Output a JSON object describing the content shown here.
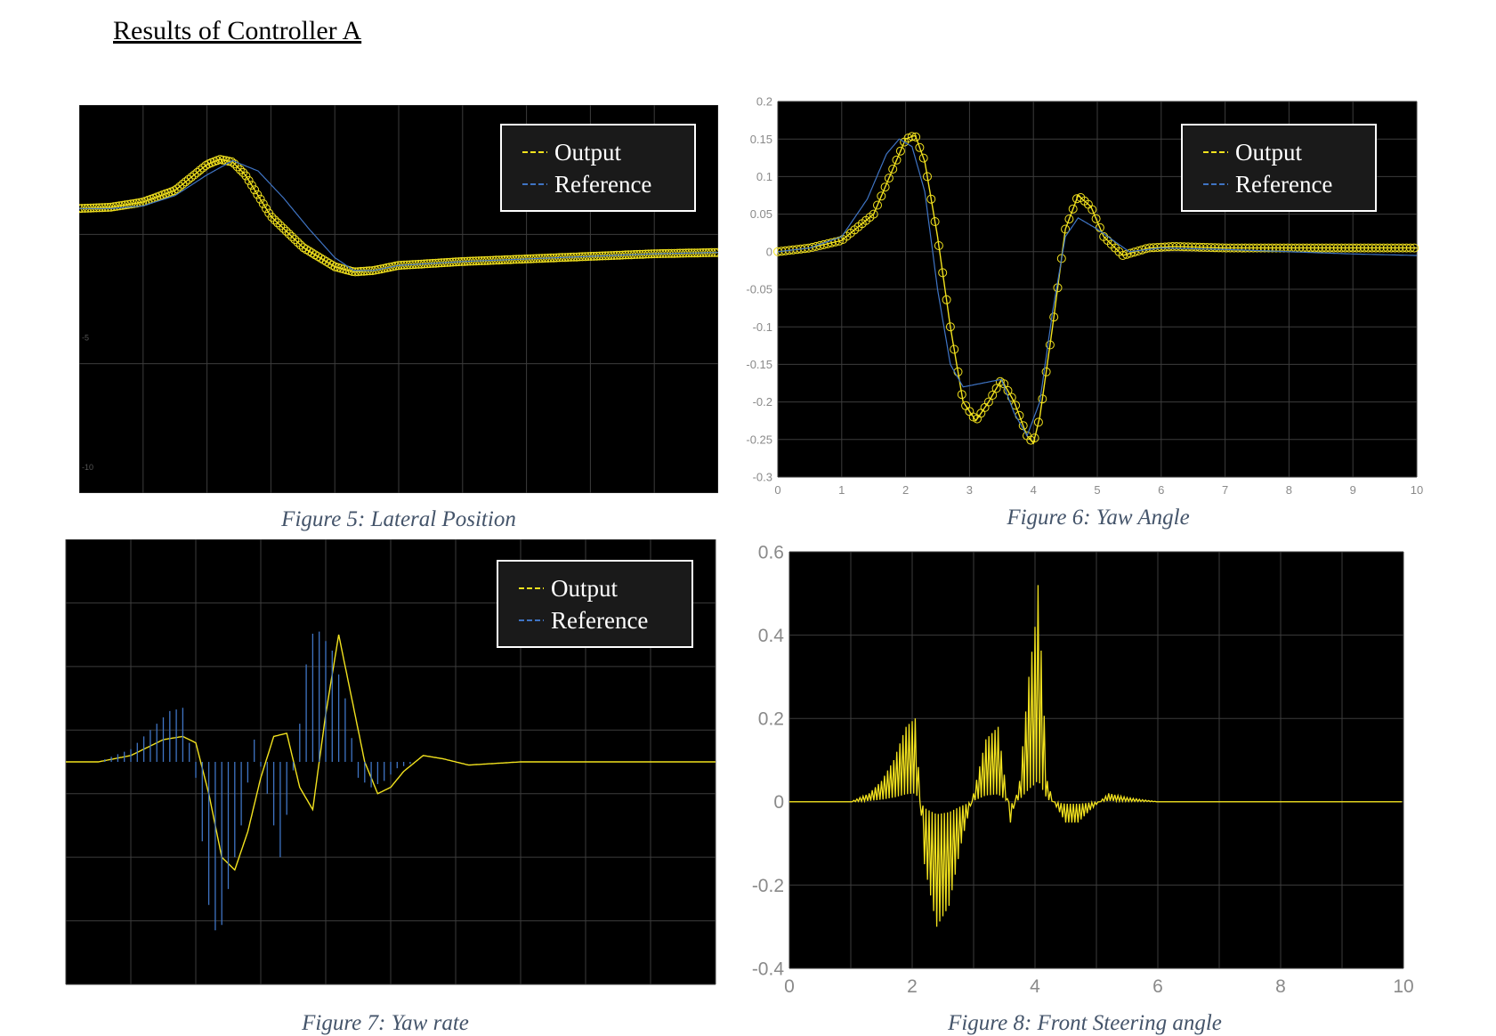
{
  "page": {
    "title": "Results of Controller A"
  },
  "colors": {
    "output": "#f2e21e",
    "reference": "#3f74c4",
    "background": "#000000",
    "grid": "#3c3c3c",
    "tick_text": "#8a8a8a",
    "caption": "#44546a"
  },
  "legend": {
    "output_label": "Output",
    "reference_label": "Reference"
  },
  "chart_data": [
    {
      "id": "fig5",
      "type": "line",
      "caption": "Figure 5: Lateral Position",
      "title": "",
      "xlabel": "",
      "ylabel": "",
      "xlim": [
        0,
        10
      ],
      "ylim": [
        -11,
        4
      ],
      "yticks": [
        -5,
        -10
      ],
      "grid": true,
      "legend": "top-right",
      "markers": "circle-dense",
      "series": [
        {
          "name": "Output",
          "x": [
            0,
            0.5,
            1,
            1.5,
            2,
            2.2,
            2.4,
            2.6,
            2.8,
            3,
            3.5,
            4,
            4.3,
            4.6,
            5,
            6,
            7,
            8,
            9,
            10
          ],
          "values": [
            0,
            0.05,
            0.25,
            0.7,
            1.7,
            1.9,
            1.8,
            1.3,
            0.5,
            -0.3,
            -1.5,
            -2.25,
            -2.45,
            -2.4,
            -2.2,
            -2.05,
            -1.95,
            -1.85,
            -1.75,
            -1.7
          ]
        },
        {
          "name": "Reference",
          "x": [
            0,
            0.5,
            1,
            1.5,
            2,
            2.4,
            2.8,
            3.2,
            3.6,
            4,
            4.3,
            4.6,
            5,
            6,
            7,
            8,
            9,
            10
          ],
          "values": [
            0,
            0,
            0.1,
            0.5,
            1.3,
            1.85,
            1.45,
            0.4,
            -0.8,
            -1.9,
            -2.4,
            -2.4,
            -2.2,
            -2.05,
            -1.95,
            -1.85,
            -1.75,
            -1.7
          ]
        }
      ]
    },
    {
      "id": "fig6",
      "type": "line",
      "caption": "Figure 6: Yaw Angle",
      "title": "",
      "xlabel": "",
      "ylabel": "",
      "xlim": [
        0,
        10
      ],
      "ylim": [
        -0.3,
        0.2
      ],
      "xticks": [
        "0",
        "1",
        "2",
        "3",
        "4",
        "5",
        "6",
        "7",
        "8",
        "9",
        "10"
      ],
      "yticks": [
        "0.2",
        "0.15",
        "0.1",
        "0.05",
        "0",
        "-0.05",
        "-0.1",
        "-0.15",
        "-0.2",
        "-0.25",
        "-0.3"
      ],
      "grid": true,
      "legend": "top-right",
      "markers": "circle",
      "series": [
        {
          "name": "Output",
          "x": [
            0,
            0.5,
            1,
            1.5,
            1.8,
            2,
            2.15,
            2.3,
            2.5,
            2.7,
            2.9,
            3.1,
            3.3,
            3.5,
            3.7,
            3.9,
            4,
            4.1,
            4.3,
            4.5,
            4.7,
            4.9,
            5.1,
            5.4,
            5.8,
            6.2,
            7,
            8,
            9,
            10
          ],
          "values": [
            0,
            0.005,
            0.015,
            0.05,
            0.11,
            0.15,
            0.155,
            0.12,
            0.02,
            -0.1,
            -0.2,
            -0.225,
            -0.2,
            -0.17,
            -0.2,
            -0.245,
            -0.255,
            -0.22,
            -0.1,
            0.03,
            0.075,
            0.06,
            0.02,
            -0.005,
            0.005,
            0.007,
            0.005,
            0.005,
            0.005,
            0.005
          ]
        },
        {
          "name": "Reference",
          "x": [
            0,
            0.5,
            1,
            1.4,
            1.7,
            1.9,
            2.1,
            2.3,
            2.5,
            2.7,
            2.9,
            3.2,
            3.5,
            3.7,
            3.9,
            4.1,
            4.3,
            4.5,
            4.7,
            5,
            5.5,
            6,
            7,
            8,
            9,
            10
          ],
          "values": [
            0,
            0.005,
            0.02,
            0.07,
            0.13,
            0.15,
            0.14,
            0.08,
            -0.05,
            -0.15,
            -0.18,
            -0.175,
            -0.17,
            -0.215,
            -0.245,
            -0.2,
            -0.08,
            0.02,
            0.045,
            0.03,
            0,
            0.005,
            0.003,
            0,
            -0.003,
            -0.005
          ]
        }
      ]
    },
    {
      "id": "fig7",
      "type": "line",
      "caption": "Figure 7: Yaw rate",
      "title": "",
      "xlabel": "",
      "ylabel": "",
      "xlim": [
        0,
        10
      ],
      "ylim": [
        -0.07,
        0.07
      ],
      "grid": true,
      "legend": "top-right",
      "series": [
        {
          "name": "Output",
          "x": [
            0,
            0.5,
            1,
            1.5,
            1.8,
            2,
            2.2,
            2.4,
            2.6,
            2.8,
            3,
            3.2,
            3.4,
            3.6,
            3.8,
            4,
            4.2,
            4.4,
            4.6,
            4.8,
            5,
            5.2,
            5.5,
            5.8,
            6.2,
            7,
            8,
            9,
            10
          ],
          "values": [
            0,
            0,
            0.002,
            0.007,
            0.008,
            0.006,
            -0.01,
            -0.03,
            -0.034,
            -0.022,
            -0.005,
            0.008,
            0.009,
            -0.008,
            -0.015,
            0.015,
            0.04,
            0.02,
            0,
            -0.01,
            -0.008,
            -0.003,
            0.002,
            0.001,
            -0.001,
            0,
            0,
            0,
            0
          ]
        },
        {
          "name": "Reference",
          "x": [
            0,
            0.5,
            1,
            1.3,
            1.6,
            1.8,
            2,
            2.2,
            2.35,
            2.5,
            2.7,
            2.9,
            3.1,
            3.3,
            3.45,
            3.6,
            3.75,
            3.9,
            4.1,
            4.3,
            4.5,
            4.7,
            4.9,
            5.1,
            5.4,
            6,
            7,
            8,
            9,
            10
          ],
          "values": [
            0,
            0,
            0.004,
            0.01,
            0.016,
            0.017,
            -0.005,
            -0.045,
            -0.057,
            -0.04,
            -0.02,
            0.007,
            -0.01,
            -0.03,
            -0.01,
            0.012,
            0.04,
            0.041,
            0.035,
            0.02,
            -0.005,
            -0.008,
            -0.006,
            -0.002,
            0,
            0,
            0,
            0,
            0,
            0
          ]
        }
      ]
    },
    {
      "id": "fig8",
      "type": "line",
      "caption": "Figure 8: Front Steering angle",
      "title": "",
      "xlabel": "",
      "ylabel": "",
      "xlim": [
        0,
        10
      ],
      "ylim": [
        -0.4,
        0.6
      ],
      "xticks": [
        "0",
        "2",
        "4",
        "6",
        "8",
        "10"
      ],
      "yticks": [
        "0.6",
        "0.4",
        "0.2",
        "0",
        "-0.2",
        "-0.4"
      ],
      "grid": true,
      "legend": "none",
      "series": [
        {
          "name": "Output",
          "x": [
            0,
            0.5,
            1,
            1.3,
            1.5,
            1.7,
            1.9,
            2.05,
            2.2,
            2.4,
            2.6,
            2.8,
            3,
            3.2,
            3.4,
            3.6,
            3.75,
            3.9,
            4,
            4.05,
            4.12,
            4.2,
            4.3,
            4.5,
            4.7,
            4.9,
            5.2,
            5.5,
            6,
            7,
            8,
            9,
            10
          ],
          "values": [
            0,
            0,
            0,
            0.02,
            0.05,
            0.1,
            0.18,
            0.2,
            -0.15,
            -0.3,
            -0.25,
            -0.1,
            0.02,
            0.15,
            0.18,
            -0.05,
            0.05,
            0.3,
            0.42,
            0.52,
            0.3,
            0.05,
            0,
            -0.05,
            -0.05,
            -0.02,
            0.02,
            0.01,
            0,
            0,
            0,
            0,
            0
          ]
        }
      ]
    }
  ]
}
